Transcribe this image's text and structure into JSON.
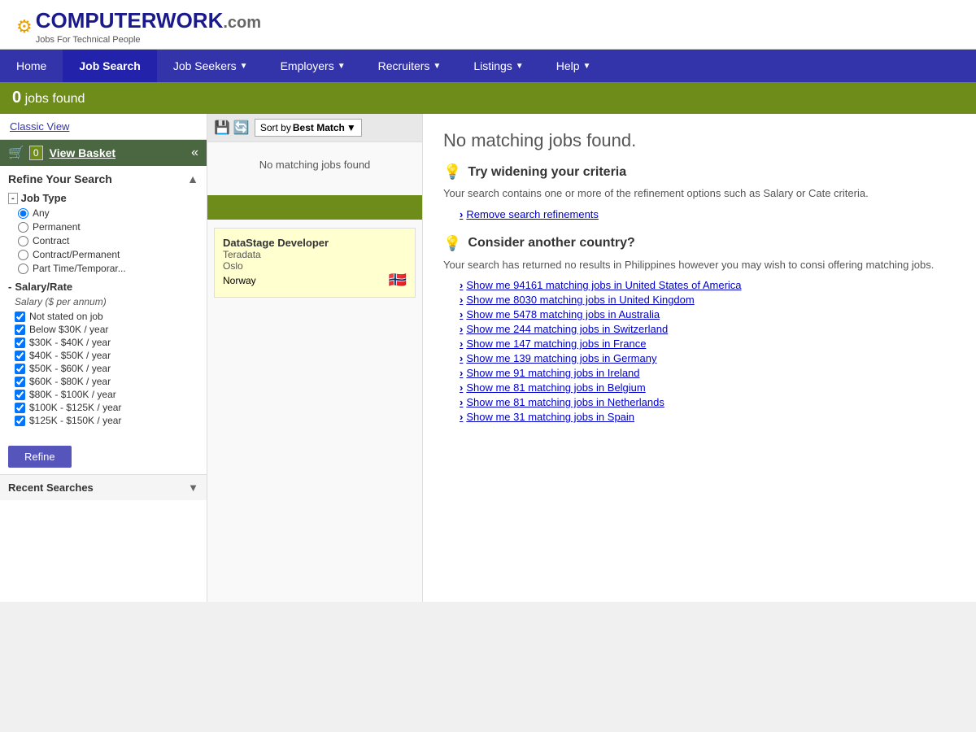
{
  "header": {
    "logo_computer": "COMPUTER",
    "logo_work": "WORK",
    "logo_dotcom": ".com",
    "logo_subtitle": "Jobs For Technical People",
    "logo_icon": "⚙"
  },
  "nav": {
    "items": [
      {
        "label": "Home",
        "active": false,
        "has_arrow": false
      },
      {
        "label": "Job Search",
        "active": true,
        "has_arrow": false
      },
      {
        "label": "Job Seekers",
        "active": false,
        "has_arrow": true
      },
      {
        "label": "Employers",
        "active": false,
        "has_arrow": true
      },
      {
        "label": "Recruiters",
        "active": false,
        "has_arrow": true
      },
      {
        "label": "Listings",
        "active": false,
        "has_arrow": true
      },
      {
        "label": "Help",
        "active": false,
        "has_arrow": true
      }
    ]
  },
  "jobs_found_bar": {
    "count": "0",
    "text": " jobs found"
  },
  "sidebar": {
    "classic_view_label": "Classic View",
    "view_basket_label": "View Basket",
    "basket_count": "0",
    "refine_title": "Refine Your Search",
    "job_type_label": "Job Type",
    "job_type_options": [
      {
        "label": "Any",
        "checked": true
      },
      {
        "label": "Permanent",
        "checked": false
      },
      {
        "label": "Contract",
        "checked": false
      },
      {
        "label": "Contract/Permanent",
        "checked": false
      },
      {
        "label": "Part Time/Temporar...",
        "checked": false
      }
    ],
    "salary_group_label": "Salary/Rate",
    "salary_per_annum_label": "Salary ($ per annum)",
    "salary_options": [
      {
        "label": "Not stated on job",
        "checked": true
      },
      {
        "label": "Below $30K / year",
        "checked": true
      },
      {
        "label": "$30K - $40K / year",
        "checked": true
      },
      {
        "label": "$40K - $50K / year",
        "checked": true
      },
      {
        "label": "$50K - $60K / year",
        "checked": true
      },
      {
        "label": "$60K - $80K / year",
        "checked": true
      },
      {
        "label": "$80K - $100K / year",
        "checked": true
      },
      {
        "label": "$100K - $125K / year",
        "checked": true
      },
      {
        "label": "$125K - $150K / year",
        "checked": true
      }
    ],
    "refine_button_label": "Refine",
    "recent_searches_label": "Recent Searches"
  },
  "center": {
    "sort_label": "Sort by ",
    "sort_value": "Best Match",
    "no_results_text": "No matching jobs found",
    "bottom_color": "#6e8c1a"
  },
  "job_card": {
    "title": "DataStage Developer",
    "company": "Teradata",
    "city": "Oslo",
    "country": "Norway"
  },
  "right": {
    "no_match_title": "No matching jobs found.",
    "suggestion1_title": "Try widening your criteria",
    "suggestion1_text": "Your search contains one or more of the refinement options such as Salary or Cate criteria.",
    "suggestion1_link_label": "Remove search refinements",
    "suggestion2_title": "Consider another country?",
    "suggestion2_text": "Your search has returned no results in Philippines however you may wish to consi offering matching jobs.",
    "country_links": [
      {
        "label": "Show me 94161 matching jobs in United States of America"
      },
      {
        "label": "Show me 8030 matching jobs in United Kingdom"
      },
      {
        "label": "Show me 5478 matching jobs in Australia"
      },
      {
        "label": "Show me 244 matching jobs in Switzerland"
      },
      {
        "label": "Show me 147 matching jobs in France"
      },
      {
        "label": "Show me 139 matching jobs in Germany"
      },
      {
        "label": "Show me 91 matching jobs in Ireland"
      },
      {
        "label": "Show me 81 matching jobs in Belgium"
      },
      {
        "label": "Show me 81 matching jobs in Netherlands"
      },
      {
        "label": "Show me 31 matching jobs in Spain"
      }
    ]
  }
}
